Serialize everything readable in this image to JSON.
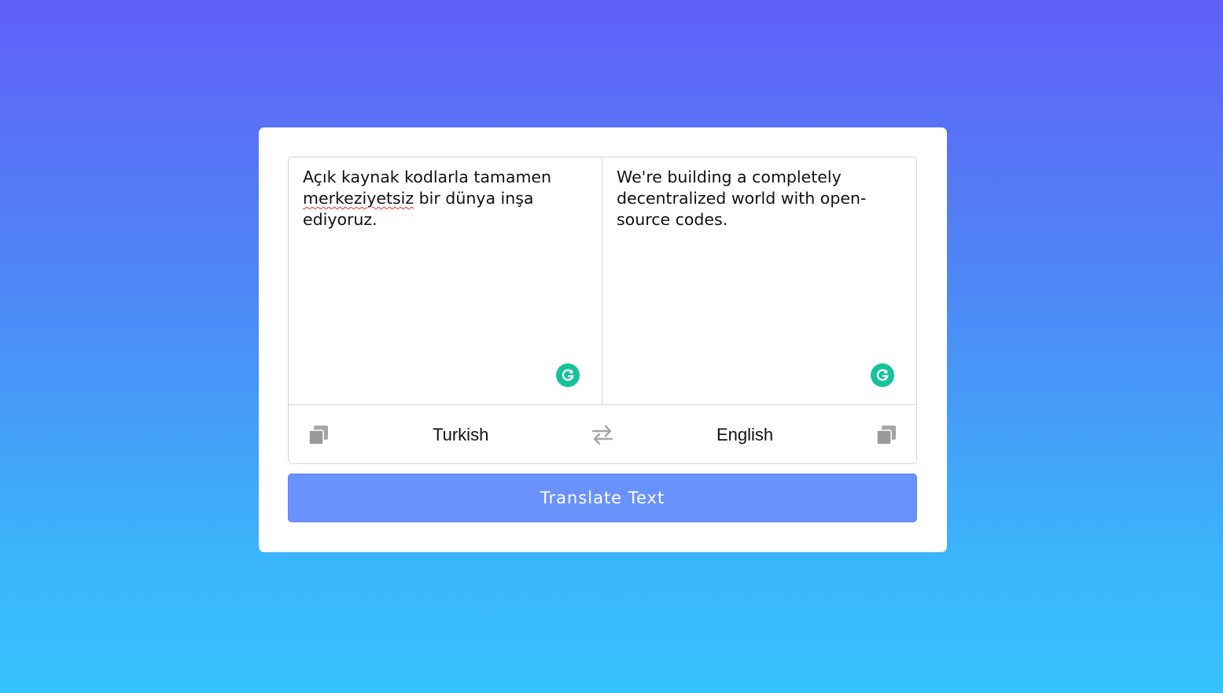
{
  "source": {
    "text_before": "Açık kaynak kodlarla tamamen\n",
    "misspelled": "merkeziyetsiz",
    "text_after": " bir dünya inşa\nediyoruz."
  },
  "target": {
    "text": "We're building a completely\ndecentralized world with open-\nsource codes."
  },
  "controls": {
    "from_language": "Turkish",
    "to_language": "English",
    "copy_icon": "copy-icon",
    "swap_icon": "swap-arrows-icon"
  },
  "grammarly_icon": "grammarly-icon",
  "translate_button": {
    "label": "Translate Text"
  },
  "colors": {
    "gradient_top": "#6060f8",
    "gradient_bottom": "#36c3fd",
    "button": "#6992fd",
    "grammarly": "#15c39a",
    "icon_gray": "#9e9e9e"
  }
}
